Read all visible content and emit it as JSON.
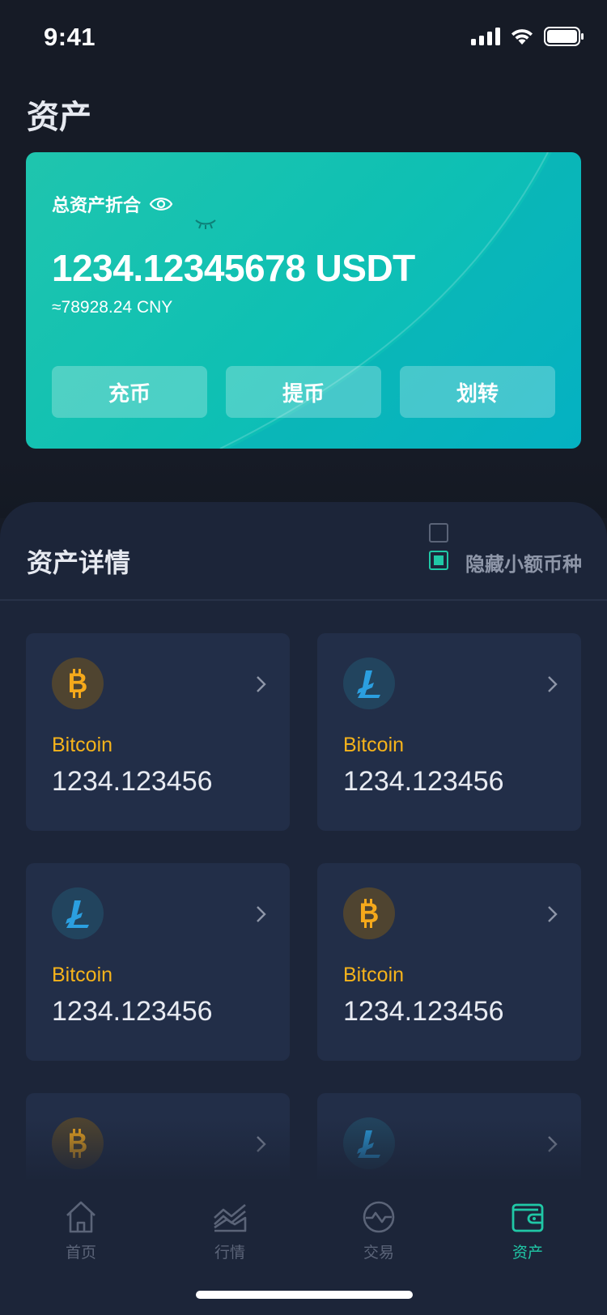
{
  "status": {
    "time": "9:41"
  },
  "page": {
    "title": "资产"
  },
  "total_card": {
    "label": "总资产折合",
    "value": "1234.12345678 USDT",
    "cny": "≈78928.24 CNY",
    "buttons": [
      "充币",
      "提币",
      "划转"
    ]
  },
  "details": {
    "title": "资产详情",
    "hide_small_label": "隐藏小额币种",
    "coins": [
      {
        "icon": "bitcoin-icon",
        "name": "Bitcoin",
        "amount": "1234.123456"
      },
      {
        "icon": "litecoin-icon",
        "name": "Bitcoin",
        "amount": "1234.123456"
      },
      {
        "icon": "litecoin-icon",
        "name": "Bitcoin",
        "amount": "1234.123456"
      },
      {
        "icon": "bitcoin-icon",
        "name": "Bitcoin",
        "amount": "1234.123456"
      },
      {
        "icon": "bitcoin-icon",
        "name": "",
        "amount": ""
      },
      {
        "icon": "litecoin-icon",
        "name": "",
        "amount": ""
      }
    ]
  },
  "tabbar": {
    "tabs": [
      {
        "label": "首页",
        "icon": "home-icon",
        "active": false
      },
      {
        "label": "行情",
        "icon": "market-chart-icon",
        "active": false
      },
      {
        "label": "交易",
        "icon": "trade-icon",
        "active": false
      },
      {
        "label": "资产",
        "icon": "wallet-icon",
        "active": true
      }
    ]
  },
  "colors": {
    "accent": "#20c8a6",
    "coin_name": "#f5b31b",
    "background": "#161b26",
    "card": "#222e48"
  }
}
